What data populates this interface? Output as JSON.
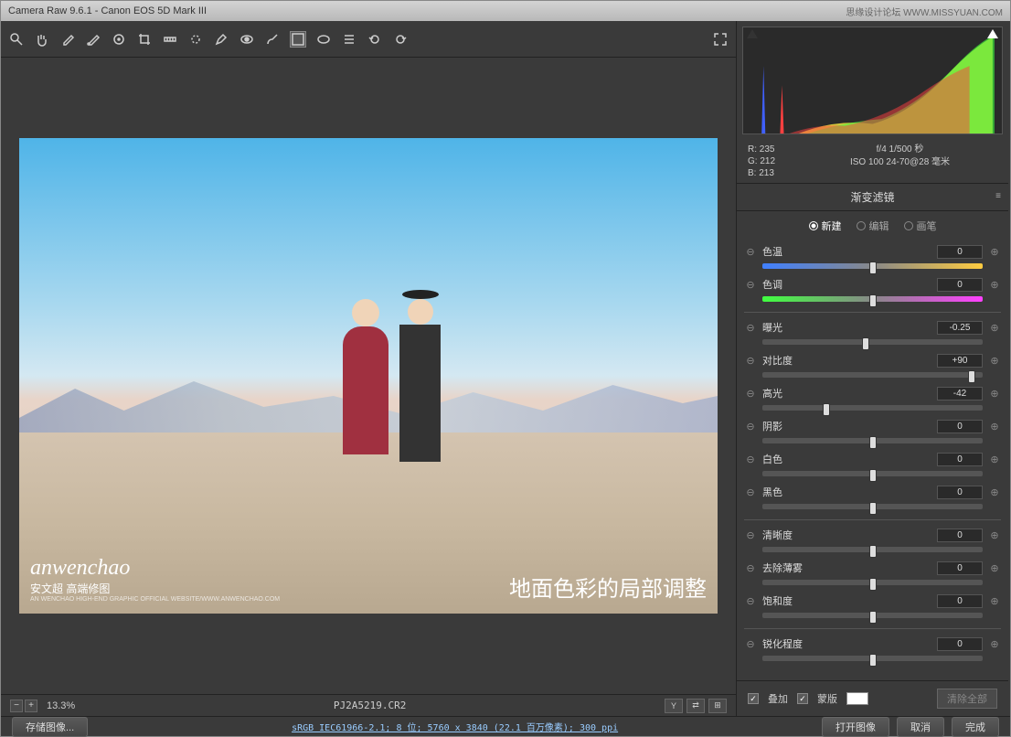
{
  "titlebar": {
    "title": "Camera Raw 9.6.1  -  Canon EOS 5D Mark III",
    "watermark_site": "思缘设计论坛 WWW.MISSYUAN.COM"
  },
  "toolbar_icons": [
    "zoom",
    "hand",
    "eyedropper",
    "color-sampler",
    "target",
    "crop",
    "straighten",
    "spot",
    "redeye",
    "brush",
    "gradient",
    "radial",
    "list",
    "rotate-ccw",
    "rotate-cw"
  ],
  "preview": {
    "watermark_brand": "anwenchao",
    "watermark_sub": "安文超 高端修图",
    "watermark_url": "AN WENCHAO HIGH-END GRAPHIC OFFICIAL WEBSITE/WWW.ANWENCHAO.COM",
    "caption": "地面色彩的局部调整"
  },
  "bottombar": {
    "zoom": "13.3%",
    "filename": "PJ2A5219.CR2"
  },
  "histogram": {
    "rgb": {
      "r": "R: 235",
      "g": "G: 212",
      "b": "B: 213"
    },
    "aperture_shutter": "f/4  1/500 秒",
    "iso_lens": "ISO 100   24-70@28 毫米"
  },
  "panel": {
    "title": "渐变滤镜",
    "radios": {
      "new": "新建",
      "edit": "编辑",
      "brush": "画笔"
    }
  },
  "sliders": [
    {
      "id": "temp",
      "label": "色温",
      "value": "0",
      "pos": 50,
      "bar": "temp"
    },
    {
      "id": "tint",
      "label": "色调",
      "value": "0",
      "pos": 50,
      "bar": "tint"
    },
    {
      "sep": true
    },
    {
      "id": "exposure",
      "label": "曝光",
      "value": "-0.25",
      "pos": 47
    },
    {
      "id": "contrast",
      "label": "对比度",
      "value": "+90",
      "pos": 95
    },
    {
      "id": "highlights",
      "label": "高光",
      "value": "-42",
      "pos": 29
    },
    {
      "id": "shadows",
      "label": "阴影",
      "value": "0",
      "pos": 50
    },
    {
      "id": "whites",
      "label": "白色",
      "value": "0",
      "pos": 50
    },
    {
      "id": "blacks",
      "label": "黑色",
      "value": "0",
      "pos": 50
    },
    {
      "sep": true
    },
    {
      "id": "clarity",
      "label": "清晰度",
      "value": "0",
      "pos": 50
    },
    {
      "id": "dehaze",
      "label": "去除薄雾",
      "value": "0",
      "pos": 50
    },
    {
      "id": "saturation",
      "label": "饱和度",
      "value": "0",
      "pos": 50
    },
    {
      "sep": true
    },
    {
      "id": "sharpness",
      "label": "锐化程度",
      "value": "0",
      "pos": 50
    }
  ],
  "options": {
    "overlay_label": "叠加",
    "mask_label": "蒙版",
    "clear_label": "清除全部"
  },
  "footer": {
    "save": "存储图像...",
    "info": "sRGB IEC61966-2.1; 8 位; 5760 x 3840 (22.1 百万像素); 300 ppi",
    "open": "打开图像",
    "cancel": "取消",
    "done": "完成"
  }
}
